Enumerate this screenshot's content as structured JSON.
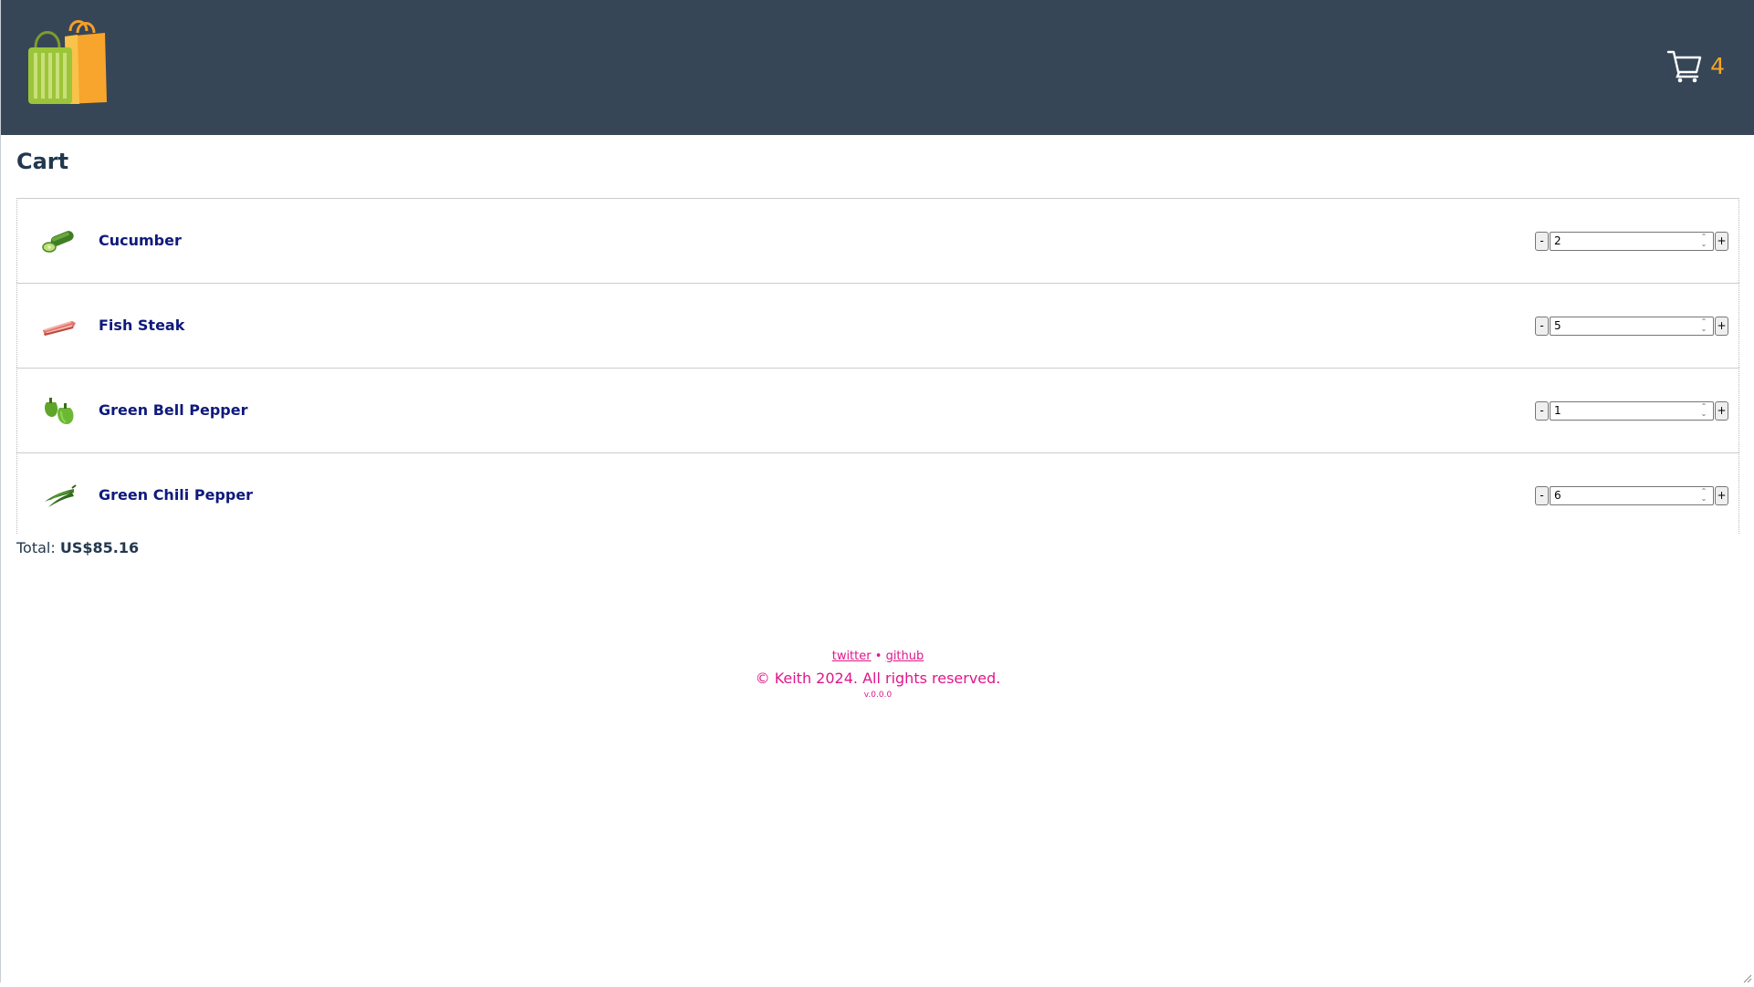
{
  "header": {
    "logo_name": "shopping-bags-logo",
    "cart_icon": "cart-icon",
    "cart_count": "4",
    "bg_color": "#364657",
    "accent_color": "#f5a623"
  },
  "page": {
    "title": "Cart"
  },
  "cart": {
    "items": [
      {
        "name": "Cucumber",
        "icon": "cucumber-icon",
        "quantity": "2",
        "minus_label": "-",
        "plus_label": "+"
      },
      {
        "name": "Fish Steak",
        "icon": "fish-steak-icon",
        "quantity": "5",
        "minus_label": "-",
        "plus_label": "+"
      },
      {
        "name": "Green Bell Pepper",
        "icon": "green-bell-pepper-icon",
        "quantity": "1",
        "minus_label": "-",
        "plus_label": "+"
      },
      {
        "name": "Green Chili Pepper",
        "icon": "green-chili-pepper-icon",
        "quantity": "6",
        "minus_label": "-",
        "plus_label": "+"
      }
    ],
    "total_label": "Total:",
    "total_value": "US$85.16"
  },
  "footer": {
    "twitter_label": "twitter",
    "separator": "•",
    "github_label": "github",
    "copyright": "© Keith 2024. All rights reserved.",
    "version": "v.0.0.0",
    "color": "#e0168c"
  }
}
